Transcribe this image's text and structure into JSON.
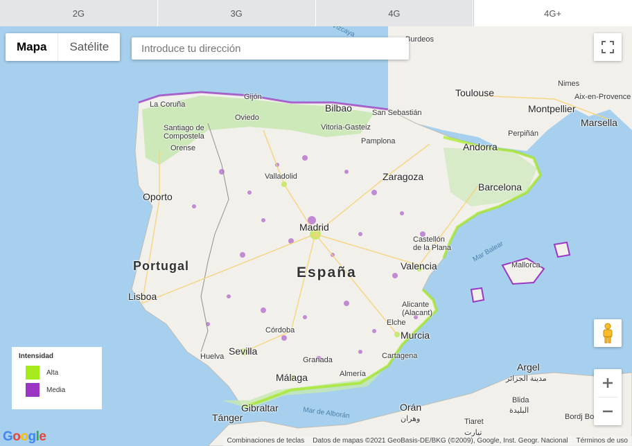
{
  "tabs": [
    {
      "label": "2G",
      "active": false
    },
    {
      "label": "3G",
      "active": false
    },
    {
      "label": "4G",
      "active": false
    },
    {
      "label": "4G+",
      "active": true
    }
  ],
  "map_type": {
    "map_label": "Mapa",
    "satellite_label": "Satélite",
    "selected": "Mapa"
  },
  "search": {
    "placeholder": "Introduce tu dirección"
  },
  "legend": {
    "title": "Intensidad",
    "items": [
      {
        "label": "Alta",
        "color": "#a4ea1c"
      },
      {
        "label": "Media",
        "color": "#9b35c4"
      }
    ]
  },
  "places": {
    "espana": "España",
    "portugal": "Portugal",
    "andorra": "Andorra",
    "madrid": "Madrid",
    "barcelona": "Barcelona",
    "valencia": "Valencia",
    "sevilla": "Sevilla",
    "malaga": "Málaga",
    "murcia": "Murcia",
    "zaragoza": "Zaragoza",
    "bilbao": "Bilbao",
    "oporto": "Oporto",
    "lisboa": "Lisboa",
    "toulouse": "Toulouse",
    "montpellier": "Montpellier",
    "marseille": "Marsella",
    "nimes": "Nimes",
    "aix": "Aix-en-Provence",
    "bordeaux": "Burdeos",
    "perpignan": "Perpiñán",
    "san_sebastian": "San Sebastián",
    "vitoria": "Vitoria-Gasteiz",
    "pamplona": "Pamplona",
    "oviedo": "Oviedo",
    "gijon": "Gijón",
    "la_coruna": "La Coruña",
    "santiago": "Santiago de Compostela",
    "orense": "Orense",
    "valladolid": "Valladolid",
    "castellon": "Castellón de la Plana",
    "alicante": "Alicante (Alacant)",
    "elche": "Elche",
    "cartagena": "Cartagena",
    "cordoba": "Córdoba",
    "granada": "Granada",
    "almeria": "Almería",
    "huelva": "Huelva",
    "gibraltar": "Gibraltar",
    "tanger": "Tánger",
    "oran": "Orán",
    "oran_ar": "وهران",
    "argel": "Argel",
    "argel_ar": "مدينة الجزائر",
    "blida": "Blida",
    "blida_ar": "البليدة",
    "tiaret": "Tiaret",
    "tiaret_ar": "تيارت",
    "bordj": "Bordj Bo",
    "mallorca": "Mallorca",
    "mar_balear": "Mar Balear",
    "mar_alboran": "Mar de Alborán",
    "vizcaya": "Vizcaya"
  },
  "attribution": {
    "shortcuts": "Combinaciones de teclas",
    "data": "Datos de mapas ©2021 GeoBasis-DE/BKG (©2009), Google, Inst. Geogr. Nacional",
    "terms": "Términos de uso"
  },
  "google_logo": "Google",
  "colors": {
    "land": "#f2f0eb",
    "sea": "#a6d0ee",
    "high": "#a4ea1c",
    "medium": "#9b35c4"
  }
}
